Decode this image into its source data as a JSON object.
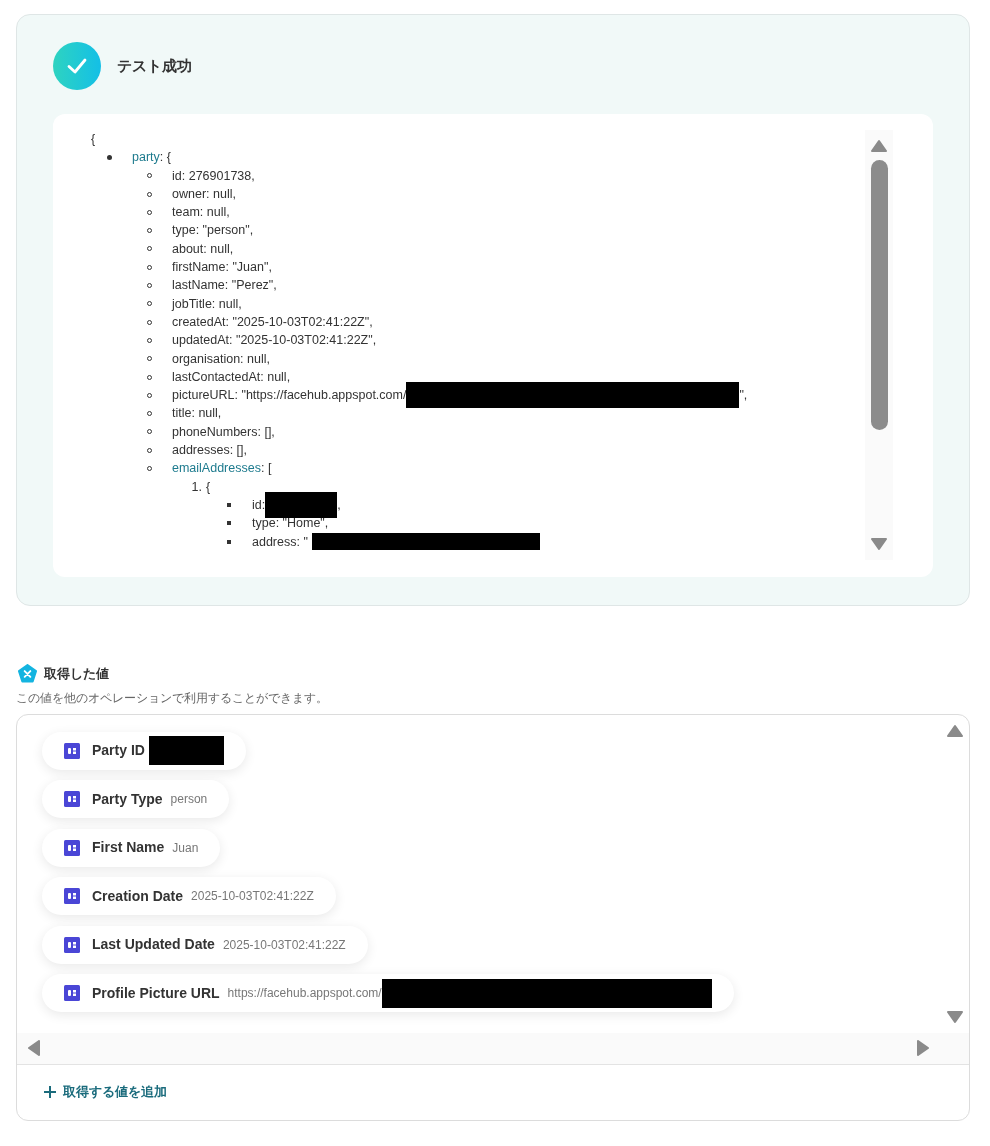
{
  "result": {
    "title": "テスト成功",
    "open": "{",
    "lines": [
      {
        "kind": "disc",
        "key": "party",
        "text": ": {",
        "children": [
          {
            "kind": "circle",
            "text": "id: 276901738,"
          },
          {
            "kind": "circle",
            "text": "owner: null,"
          },
          {
            "kind": "circle",
            "text": "team: null,"
          },
          {
            "kind": "circle",
            "text": "type: \"person\","
          },
          {
            "kind": "circle",
            "text": "about: null,"
          },
          {
            "kind": "circle",
            "text": "firstName: \"Juan\","
          },
          {
            "kind": "circle",
            "text": "lastName: \"Perez\","
          },
          {
            "kind": "circle",
            "text": "jobTitle: null,"
          },
          {
            "kind": "circle",
            "text": "createdAt: \"2025-10-03T02:41:22Z\","
          },
          {
            "kind": "circle",
            "text": "updatedAt: \"2025-10-03T02:41:22Z\","
          },
          {
            "kind": "circle",
            "text": "organisation: null,"
          },
          {
            "kind": "circle",
            "text": "lastContactedAt: null,"
          },
          {
            "kind": "circle",
            "text": "pictureURL: \"https://facehub.appspot.com/",
            "redacted": true,
            "after": "\","
          },
          {
            "kind": "circle",
            "text": "title: null,"
          },
          {
            "kind": "circle",
            "text": "phoneNumbers: [],"
          },
          {
            "kind": "circle",
            "text": "addresses: [],"
          },
          {
            "kind": "circle",
            "key": "emailAddresses",
            "text": ": [",
            "children": [
              {
                "kind": "number",
                "number": "1.",
                "text": "{",
                "children": [
                  {
                    "kind": "square",
                    "text": "id:",
                    "redacted": true,
                    "after": ","
                  },
                  {
                    "kind": "square",
                    "text": "type: \"Home\","
                  },
                  {
                    "kind": "square",
                    "text": "address: \"",
                    "redacted": true
                  }
                ]
              }
            ]
          }
        ]
      }
    ]
  },
  "values": {
    "title": "取得した値",
    "description": "この値を他のオペレーションで利用することができます。",
    "items": [
      {
        "label": "Party ID",
        "redacted": true
      },
      {
        "label": "Party Type",
        "value": "person"
      },
      {
        "label": "First Name",
        "value": "Juan"
      },
      {
        "label": "Creation Date",
        "value": "2025-10-03T02:41:22Z"
      },
      {
        "label": "Last Updated Date",
        "value": "2025-10-03T02:41:22Z"
      },
      {
        "label": "Profile Picture URL",
        "value": "https://facehub.appspot.com/",
        "redacted": true
      }
    ],
    "add_button": "取得する値を追加"
  }
}
